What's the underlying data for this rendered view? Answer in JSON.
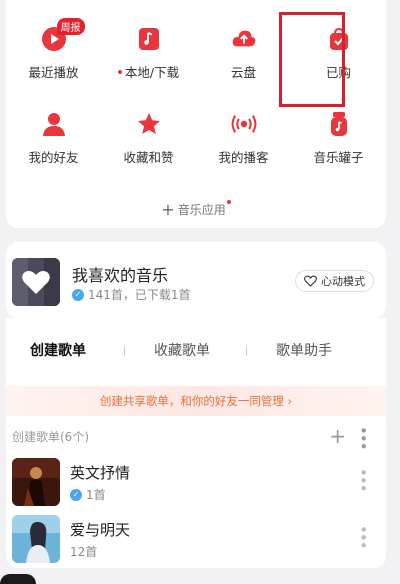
{
  "quick_access": {
    "weekly_badge": "周报",
    "items": [
      {
        "label": "最近播放",
        "icon": "play-circle-icon"
      },
      {
        "label": "本地/下载",
        "icon": "music-note-box-icon"
      },
      {
        "label": "云盘",
        "icon": "cloud-upload-icon"
      },
      {
        "label": "已购",
        "icon": "shopping-bag-check-icon"
      },
      {
        "label": "我的好友",
        "icon": "person-icon"
      },
      {
        "label": "收藏和赞",
        "icon": "star-icon"
      },
      {
        "label": "我的播客",
        "icon": "broadcast-icon"
      },
      {
        "label": "音乐罐子",
        "icon": "music-jar-icon"
      }
    ],
    "music_apps_label": "音乐应用"
  },
  "favorites": {
    "title": "我喜欢的音乐",
    "subtitle": "141首，已下载1首",
    "heart_mode_label": "心动模式"
  },
  "playlist_tabs": {
    "tabs": [
      "创建歌单",
      "收藏歌单",
      "歌单助手"
    ],
    "active_index": 0
  },
  "share_banner": "创建共享歌单，和你的好友一同管理 ›",
  "created_section": {
    "header": "创建歌单(6个)",
    "playlists": [
      {
        "name": "英文抒情",
        "count": "1首"
      },
      {
        "name": "爱与明天",
        "count": "12首"
      }
    ]
  },
  "colors": {
    "accent": "#e2232e",
    "highlight_box": "#d8202c",
    "banner_text": "#e8703c",
    "verify_badge": "#4aa6e8"
  }
}
